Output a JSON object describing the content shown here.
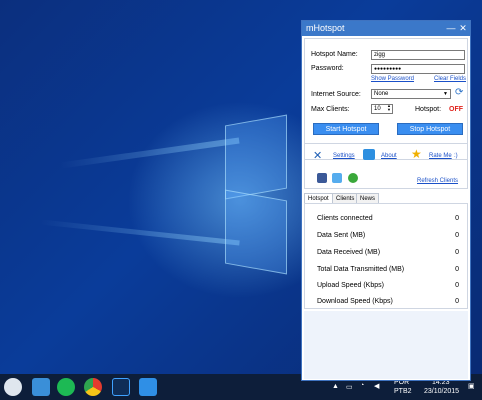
{
  "window": {
    "title": "mHotspot",
    "controls": {
      "minimize": "—",
      "close": "✕"
    }
  },
  "settings": {
    "hotspot_name_label": "Hotspot Name:",
    "hotspot_name_value": "zigg",
    "password_label": "Password:",
    "password_value": "●●●●●●●●●",
    "show_password": "Show Password",
    "clear_fields": "Clear Fields",
    "internet_source_label": "Internet Source:",
    "internet_source_value": "None",
    "max_clients_label": "Max Clients:",
    "max_clients_value": "10",
    "hotspot_status_label": "Hotspot:",
    "hotspot_status_value": "OFF",
    "start_button": "Start Hotspot",
    "stop_button": "Stop Hotspot"
  },
  "links": {
    "settings": "Settings",
    "about": "About",
    "rate_me": "Rate Me",
    "rate_suffix": ":)",
    "refresh_clients": "Refresh Clients"
  },
  "tabs": [
    {
      "label": "Hotspot",
      "active": true
    },
    {
      "label": "Clients",
      "active": false
    },
    {
      "label": "News",
      "active": false
    }
  ],
  "stats": [
    {
      "name": "Clients connected",
      "value": "0"
    },
    {
      "name": "Data Sent (MB)",
      "value": "0"
    },
    {
      "name": "Data Received (MB)",
      "value": "0"
    },
    {
      "name": "Total Data Transmitted (MB)",
      "value": "0"
    },
    {
      "name": "Upload Speed (Kbps)",
      "value": "0"
    },
    {
      "name": "Download Speed (Kbps)",
      "value": "0"
    }
  ],
  "taskbar": {
    "language": "POR",
    "layout": "PTB2",
    "time": "14:23",
    "date": "23/10/2015"
  },
  "colors": {
    "accent": "#3b78c9",
    "button": "#3a8ef0",
    "status_off": "#e0211b",
    "link": "#1a50c8"
  }
}
